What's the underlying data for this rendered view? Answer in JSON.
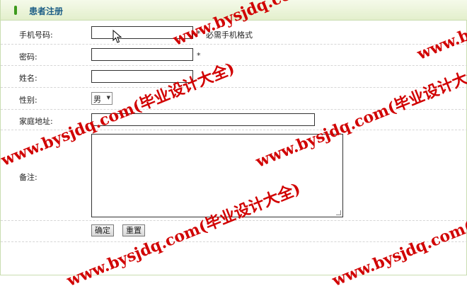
{
  "panel": {
    "title": "患者注册"
  },
  "form": {
    "phone_label": "手机号码:",
    "phone_value": "",
    "phone_required": "*",
    "phone_hint": "必需手机格式",
    "password_label": "密码:",
    "password_value": "",
    "password_required": "*",
    "name_label": "姓名:",
    "name_value": "",
    "gender_label": "性别:",
    "gender_selected": "男",
    "address_label": "家庭地址:",
    "address_value": "",
    "remark_label": "备注:",
    "remark_value": "",
    "confirm_button": "确定",
    "reset_button": "重置"
  },
  "watermark": {
    "text": "www.bysjdq.com(毕业设计大全)"
  },
  "colors": {
    "accent": "#3d9a1c",
    "title": "#1d5e86",
    "watermark": "#d10000",
    "header_bg": "#e3efcc"
  }
}
